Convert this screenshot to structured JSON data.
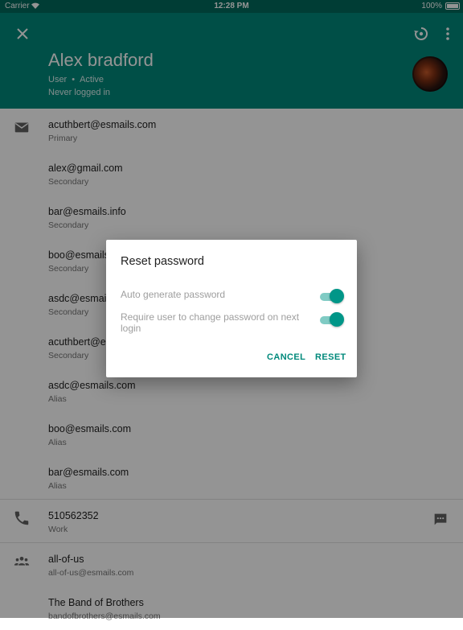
{
  "status_bar": {
    "carrier": "Carrier",
    "time": "12:28 PM",
    "battery": "100%"
  },
  "header": {
    "name": "Alex bradford",
    "role": "User",
    "separator": "•",
    "status": "Active",
    "last_login": "Never logged in"
  },
  "emails": [
    {
      "address": "acuthbert@esmails.com",
      "type": "Primary"
    },
    {
      "address": "alex@gmail.com",
      "type": "Secondary"
    },
    {
      "address": "bar@esmails.info",
      "type": "Secondary"
    },
    {
      "address": "boo@esmails",
      "type": "Secondary"
    },
    {
      "address": "asdc@esmail",
      "type": "Secondary"
    },
    {
      "address": "acuthbert@e",
      "type": "Secondary"
    },
    {
      "address": "asdc@esmails.com",
      "type": "Alias"
    },
    {
      "address": "boo@esmails.com",
      "type": "Alias"
    },
    {
      "address": "bar@esmails.com",
      "type": "Alias"
    }
  ],
  "phone": {
    "number": "510562352",
    "type": "Work"
  },
  "groups": [
    {
      "name": "all-of-us",
      "email": "all-of-us@esmails.com"
    },
    {
      "name": "The Band of Brothers",
      "email": "bandofbrothers@esmails.com"
    }
  ],
  "dialog": {
    "title": "Reset password",
    "option_auto_generate": "Auto generate password",
    "option_require_change": "Require user to change password on next login",
    "cancel_label": "CANCEL",
    "reset_label": "RESET"
  },
  "colors": {
    "header": "#00897b",
    "status_bar": "#00695c",
    "accent": "#009688"
  }
}
